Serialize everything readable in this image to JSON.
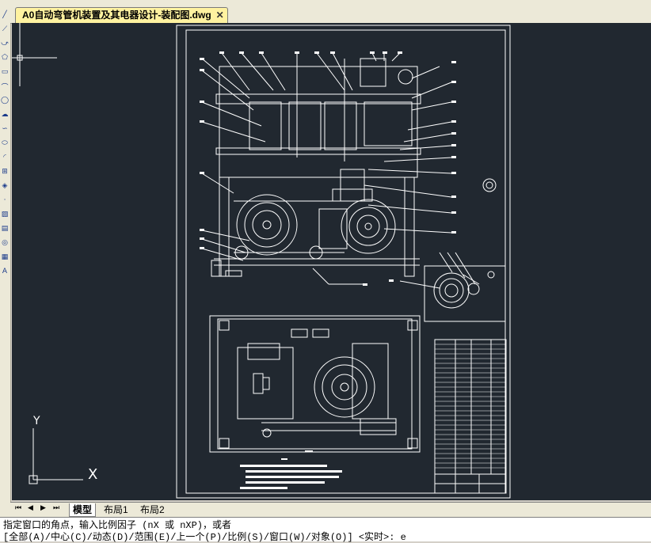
{
  "document_tab": {
    "title": "A0自动弯管机装置及其电器设计-装配图.dwg",
    "close": "✕"
  },
  "left_toolbar": {
    "icons": [
      "line-icon",
      "construction-line-icon",
      "polyline-icon",
      "polygon-icon",
      "rectangle-icon",
      "arc-icon",
      "circle-icon",
      "cloud-icon",
      "spline-icon",
      "ellipse-icon",
      "ellipse-arc-icon",
      "insert-block-icon",
      "make-block-icon",
      "point-icon",
      "hatch-icon",
      "gradient-icon",
      "region-icon",
      "table-icon",
      "multiline-text-icon"
    ]
  },
  "layout_bar": {
    "nav_first": "⏮",
    "nav_prev": "◀",
    "nav_next": "▶",
    "nav_last": "⏭",
    "tabs": [
      "模型",
      "布局1",
      "布局2"
    ]
  },
  "ucs": {
    "x_label": "X",
    "y_label": "Y"
  },
  "command_line": {
    "line1": "指定窗口的角点，输入比例因子 (nX 或 nXP)，或者",
    "line2": "[全部(A)/中心(C)/动态(D)/范围(E)/上一个(P)/比例(S)/窗口(W)/对象(O)] <实时>:  e"
  },
  "colors": {
    "canvas": "#212830",
    "line": "#ffffff",
    "tab_active": "#fff2a0",
    "toolbar": "#ece9d8"
  }
}
